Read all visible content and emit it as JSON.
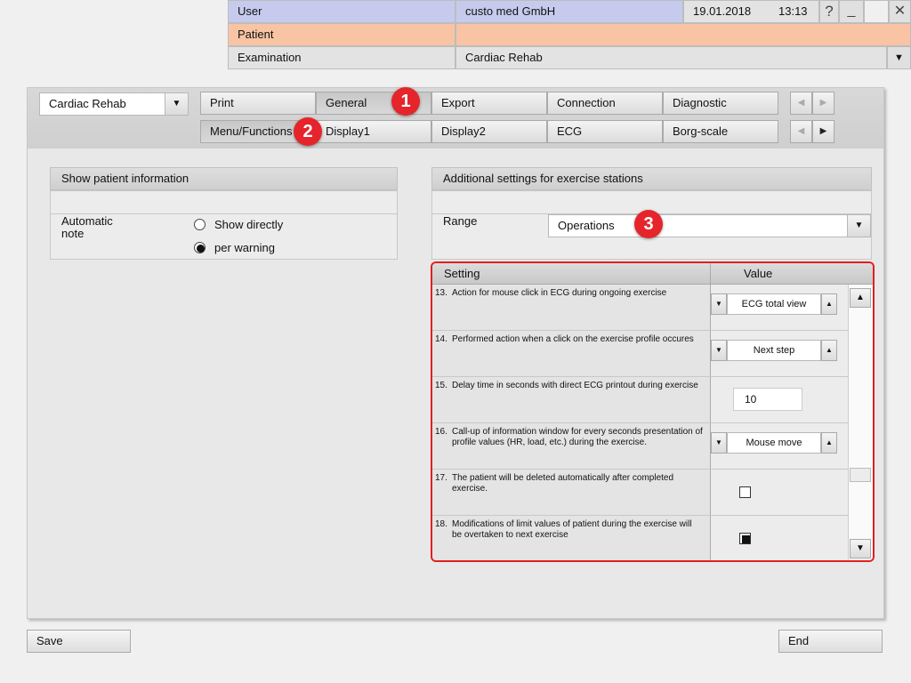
{
  "header": {
    "user_label": "User",
    "company": "custo med GmbH",
    "date": "19.01.2018",
    "time": "13:13",
    "help_icon": "?",
    "minimize_icon": "_",
    "close_icon": "✕",
    "patient_label": "Patient",
    "examination_label": "Examination",
    "examination_value": "Cardiac Rehab"
  },
  "module_select": {
    "value": "Cardiac Rehab"
  },
  "tabs_row1": [
    "Print",
    "General",
    "Export",
    "Connection",
    "Diagnostic"
  ],
  "tabs_row2": [
    "Menu/Functions",
    "Display1",
    "Display2",
    "ECG",
    "Borg-scale"
  ],
  "active_tab_row1": "General",
  "active_tab_row2": "Menu/Functions",
  "left_section": {
    "title": "Show patient information",
    "label": "Automatic note",
    "options": [
      "Show directly",
      "per warning"
    ],
    "selected": "per warning"
  },
  "right_section": {
    "title": "Additional settings for exercise stations",
    "range_label": "Range",
    "range_value": "Operations"
  },
  "table": {
    "col_setting": "Setting",
    "col_value": "Value",
    "rows": [
      {
        "num": "13.",
        "text": "Action for mouse click in ECG during ongoing exercise",
        "type": "spin",
        "value": "ECG total view"
      },
      {
        "num": "14.",
        "text": "Performed action when a click on the exercise profile occures",
        "type": "spin",
        "value": "Next step"
      },
      {
        "num": "15.",
        "text": "Delay time in seconds with direct ECG printout during exercise",
        "type": "input",
        "value": "10"
      },
      {
        "num": "16.",
        "text": "Call-up of  information window for every seconds presentation of profile values (HR, load, etc.) during the exercise.",
        "type": "spin",
        "value": "Mouse move"
      },
      {
        "num": "17.",
        "text": "The patient will be deleted automatically after completed exercise.",
        "type": "check",
        "value": false
      },
      {
        "num": "18.",
        "text": "Modifications of limit values of patient during the exercise will be overtaken to next exercise",
        "type": "check",
        "value": true
      }
    ]
  },
  "badges": [
    "1",
    "2",
    "3"
  ],
  "buttons": {
    "save": "Save",
    "end": "End"
  },
  "colors": {
    "user_row": "#c6cbee",
    "patient_row": "#f8c4a3",
    "badge": "#e5252b",
    "highlight_border": "#e02020"
  }
}
